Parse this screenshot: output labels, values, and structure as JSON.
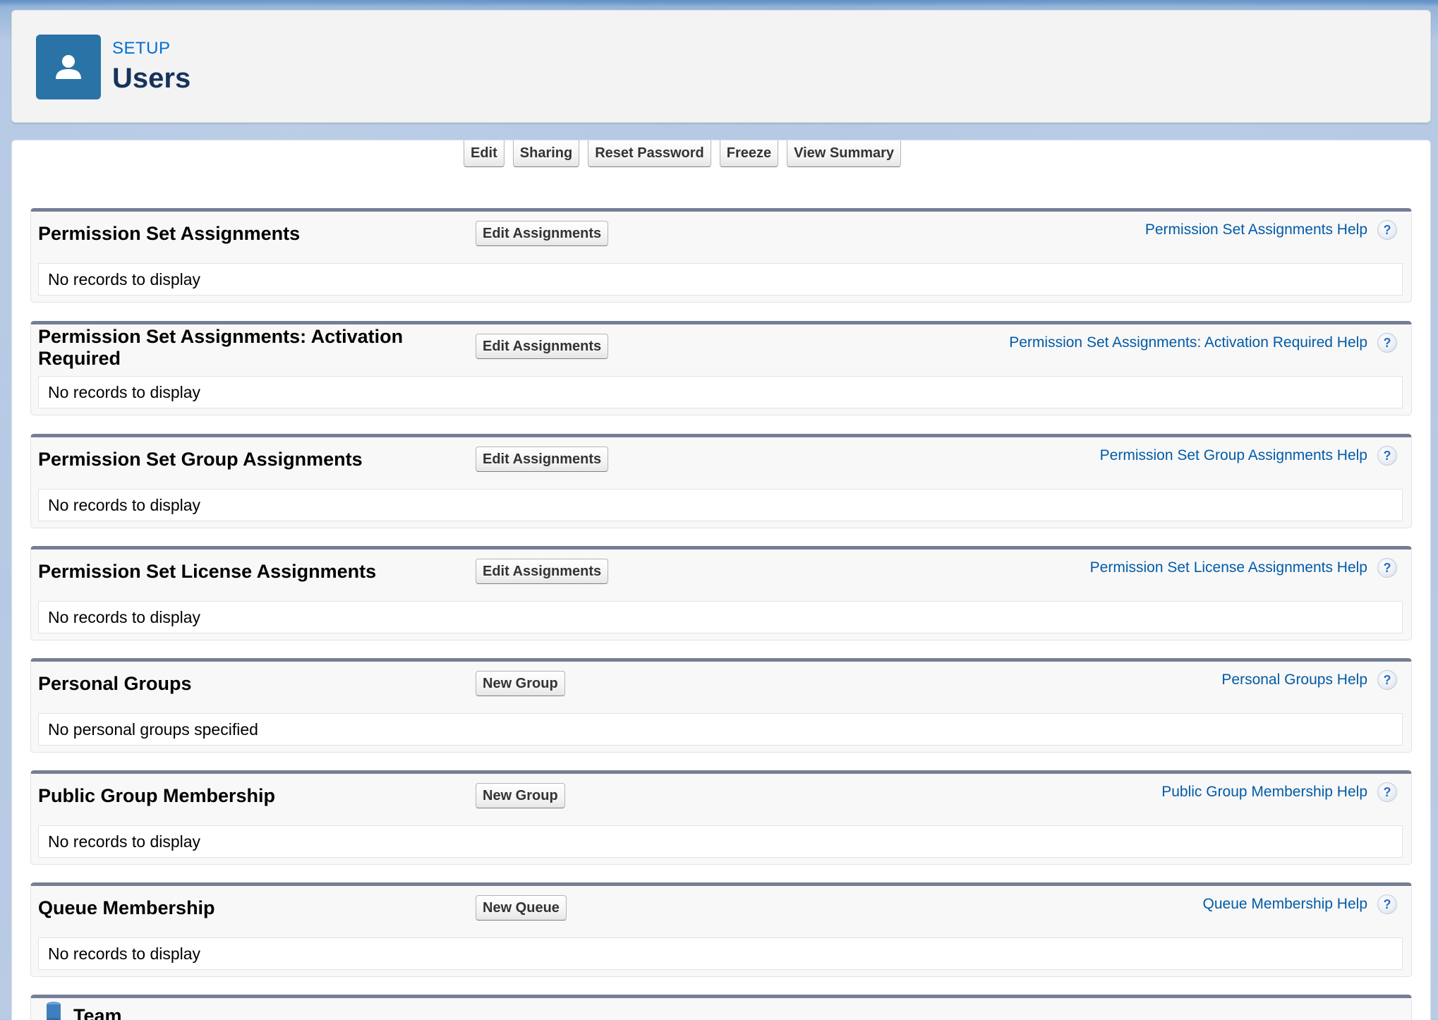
{
  "header": {
    "eyebrow": "SETUP",
    "title": "Users",
    "icon": "user-icon"
  },
  "toolbar": {
    "buttons": [
      {
        "label": "Edit"
      },
      {
        "label": "Sharing"
      },
      {
        "label": "Reset Password"
      },
      {
        "label": "Freeze"
      },
      {
        "label": "View Summary"
      }
    ]
  },
  "sections": [
    {
      "title": "Permission Set Assignments",
      "button": "Edit Assignments",
      "help": "Permission Set Assignments Help",
      "body": "No records to display"
    },
    {
      "title": "Permission Set Assignments: Activation Required",
      "button": "Edit Assignments",
      "help": "Permission Set Assignments: Activation Required Help",
      "body": "No records to display"
    },
    {
      "title": "Permission Set Group Assignments",
      "button": "Edit Assignments",
      "help": "Permission Set Group Assignments Help",
      "body": "No records to display"
    },
    {
      "title": "Permission Set License Assignments",
      "button": "Edit Assignments",
      "help": "Permission Set License Assignments Help",
      "body": "No records to display"
    },
    {
      "title": "Personal Groups",
      "button": "New Group",
      "help": "Personal Groups Help",
      "body": "No personal groups specified"
    },
    {
      "title": "Public Group Membership",
      "button": "New Group",
      "help": "Public Group Membership Help",
      "body": "No records to display"
    },
    {
      "title": "Queue Membership",
      "button": "New Queue",
      "help": "Queue Membership Help",
      "body": "No records to display"
    },
    {
      "title": "Team",
      "icon": "team-icon"
    }
  ],
  "help_icon_glyph": "?",
  "colors": {
    "accent": "#2a73a6",
    "link": "#015ba7",
    "section_border": "#747e96"
  }
}
